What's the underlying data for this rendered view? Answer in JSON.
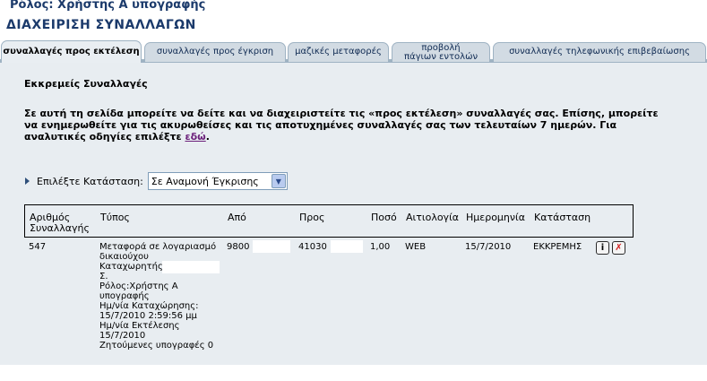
{
  "header": {
    "role": "Ρόλος: Χρήστης Α υπογραφής",
    "title": "ΔΙΑΧΕΙΡΙΣΗ ΣΥΝΑΛΛΑΓΩΝ"
  },
  "tabs": [
    {
      "label": "συναλλαγές προς εκτέλεση",
      "active": true
    },
    {
      "label": "συναλλαγές προς έγκριση",
      "active": false
    },
    {
      "label": "μαζικές μεταφορές",
      "active": false
    },
    {
      "label_line1": "προβολή",
      "label_line2": "πάγιων εντολών",
      "active": false
    },
    {
      "label": "συναλλαγές τηλεφωνικής επιβεβαίωσης",
      "active": false
    }
  ],
  "section": {
    "title": "Εκκρεμείς Συναλλαγές",
    "intro": "Σε αυτή τη σελίδα μπορείτε να δείτε και να διαχειριστείτε τις «προς εκτέλεση» συναλλαγές σας. Επίσης, μπορείτε να ενημερωθείτε για τις ακυρωθείσες και τις αποτυχημένες συναλλαγές σας των τελευταίων 7 ημερών. Για αναλυτικές οδηγίες επιλέξτε ",
    "intro_link": "εδώ",
    "intro_end": "."
  },
  "filter": {
    "label": "Επιλέξτε Κατάσταση:",
    "selected": "Σε Αναμονή Έγκρισης"
  },
  "table": {
    "headers": [
      "Αριθμός Συναλλαγής",
      "Τύπος",
      "Από",
      "Προς",
      "Ποσό",
      "Αιτιολογία",
      "Ημερομηνία",
      "Κατάσταση"
    ],
    "rows": [
      {
        "id": "547",
        "type": "Μεταφορά σε λογαριασμό δικαιούχου",
        "created_by": "Καταχωρητής:ΑΡ",
        "created_by_cont": "Σ.",
        "role": "Ρόλος:Χρήστης Α υπογραφής",
        "entry_date_label": "Ημ/νία Καταχώρησης:",
        "entry_date": "15/7/2010 2:59:56 μμ",
        "exec_date_label": "Ημ/νία Εκτέλεσης",
        "exec_date": "15/7/2010",
        "signatures": "Ζητούμενες υπογραφές 0",
        "from": "9800",
        "to": "41030",
        "amount": "1,00",
        "reason": "WEB",
        "date": "15/7/2010",
        "status": "ΕΚΚΡΕΜΗΣ"
      }
    ]
  },
  "icons": {
    "info": "info-icon",
    "delete": "delete-icon",
    "arrow": "arrow-right-icon",
    "dropdown": "chevron-down-icon"
  },
  "colors": {
    "title": "#1b3a6b",
    "tab_bg": "#d2dbe3",
    "content_bg": "#e8edf1",
    "link": "#6b1f7a",
    "delete": "#d21a1a"
  }
}
